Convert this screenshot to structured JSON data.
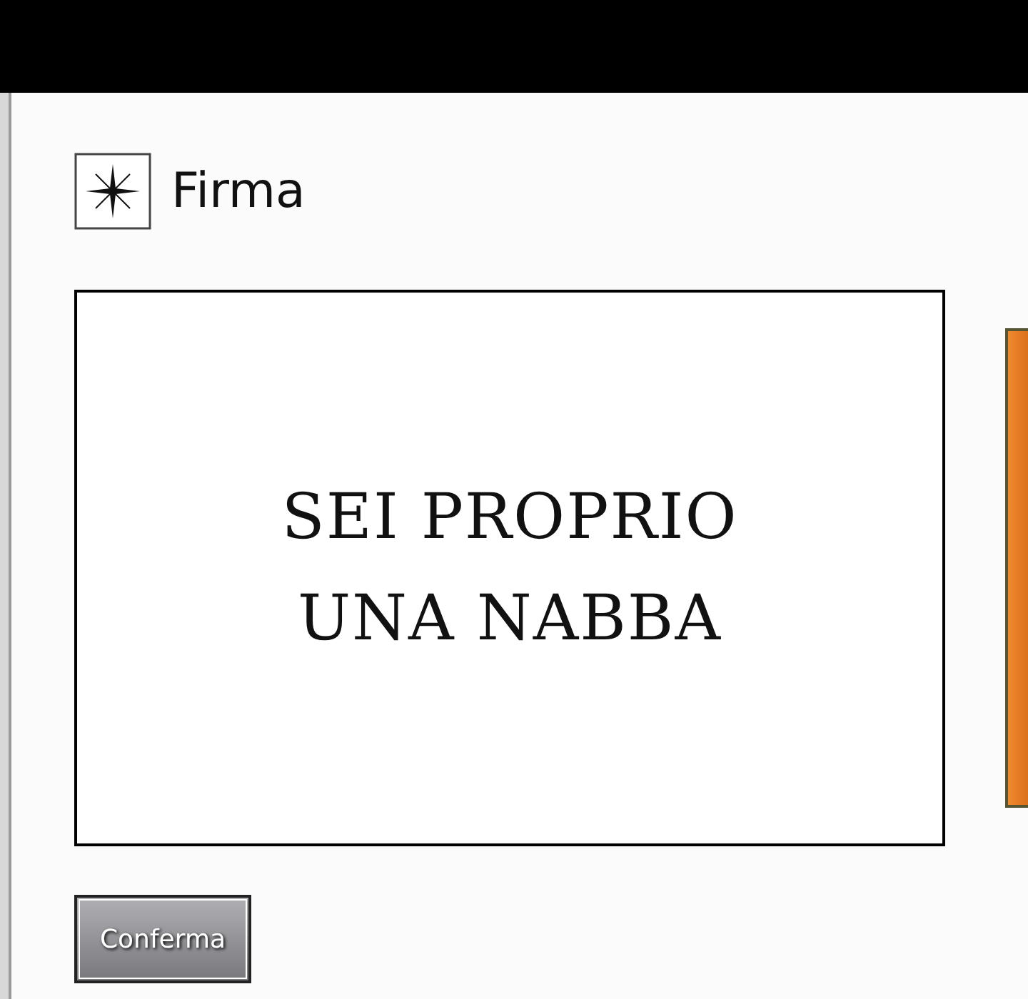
{
  "dialog": {
    "title": "Firma"
  },
  "signature_box": {
    "lines": [
      "SEI PROPRIO",
      "UNA NABBA"
    ]
  },
  "buttons": [
    "Conferma"
  ]
}
